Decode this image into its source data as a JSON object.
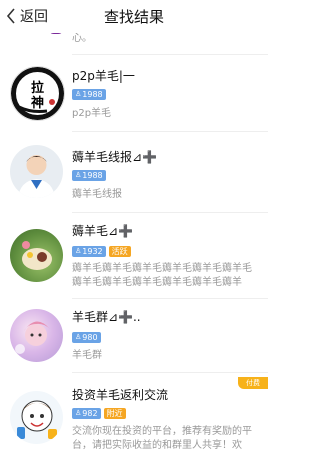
{
  "header": {
    "back_label": "返回",
    "title": "查找结果"
  },
  "partial_top": {
    "desc": "心。"
  },
  "results": [
    {
      "name": "p2p羊毛|一",
      "badges": [
        {
          "text": "1988",
          "color": "blue",
          "icon": "person-icon"
        }
      ],
      "desc": "p2p羊毛",
      "avatar_text": [
        "拉",
        "神"
      ]
    },
    {
      "name": "薅羊毛线报⊿➕",
      "badges": [
        {
          "text": "1988",
          "color": "blue",
          "icon": "person-icon"
        }
      ],
      "desc": "薅羊毛线报"
    },
    {
      "name": "薅羊毛⊿➕",
      "badges": [
        {
          "text": "1932",
          "color": "blue",
          "icon": "person-icon"
        },
        {
          "text": "活跃",
          "color": "orange"
        }
      ],
      "desc": "薅羊毛薅羊毛薅羊毛薅羊毛薅羊毛薅羊毛薅羊毛薅羊毛薅羊毛薅羊毛薅羊毛薅羊毛..."
    },
    {
      "name": "羊毛群⊿➕..",
      "badges": [
        {
          "text": "980",
          "color": "blue",
          "icon": "person-icon"
        }
      ],
      "desc": "羊毛群"
    },
    {
      "name": "投资羊毛返利交流",
      "badges": [
        {
          "text": "982",
          "color": "blue",
          "icon": "person-icon"
        },
        {
          "text": "附近",
          "color": "orange"
        }
      ],
      "desc": "交流你现在投资的平台，推荐有奖励的平台，请把实际收益的和群里人共享！欢迎...",
      "tag": "付费"
    }
  ],
  "colors": {
    "badge_blue": "#6aa3e6",
    "badge_orange": "#f5a623",
    "pay_tag": "#f7b21a"
  }
}
